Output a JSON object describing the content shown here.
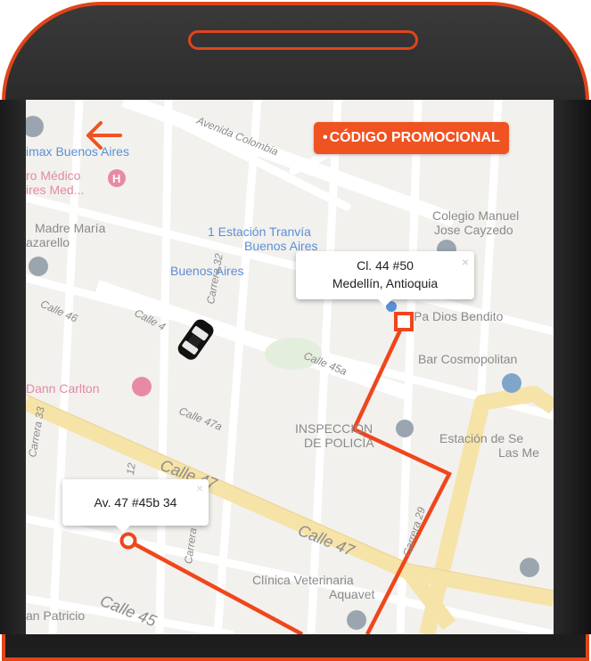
{
  "header": {
    "back_icon": "arrow-left-icon",
    "promo_label": "CÓDIGO PROMOCIONAL"
  },
  "colors": {
    "accent": "#f05322",
    "route": "#f0461b",
    "phone_frame": "#e0451a"
  },
  "map": {
    "places": {
      "cinema": "imax Buenos Aires",
      "medical_1": "ro Médico",
      "medical_2": "ires Med...",
      "church_1": "Madre María",
      "church_2": "azarello",
      "station_1": "1 Estación Tranvía",
      "station_2": "Buenos Aires",
      "buenos_aires": "Buenos Aires",
      "school_1": "Colegio Manuel",
      "school_2": "Jose Cayzedo",
      "pa_dios": "Pa Dios Bendito",
      "bar": "Bar Cosmopolitan",
      "hotel": "Dann Carlton",
      "inspeccion_1": "INSPECCIÓN",
      "inspeccion_2": "DE POLICÍA",
      "estacion_1": "Estación de Se",
      "estacion_2": "Las Me",
      "vet_1": "Clínica Veterinaria",
      "vet_2": "Aquavet",
      "san_patricio": "an Patricio"
    },
    "roads": {
      "colombia": "Avenida Colombia",
      "carrera_32": "Carrera 32",
      "calle_46": "Calle 46",
      "calle_4": "Calle 4",
      "calle_45a": "Calle 45a",
      "calle_47a": "Calle 47a",
      "calle_47_big": "Calle 47",
      "calle_47_b": "Calle 47",
      "carrera_29": "Carrera 29",
      "carrera_33": "Carrera 33",
      "carrera": "Carrera",
      "calle_45": "Calle 45",
      "cra_12": "12"
    }
  },
  "destination": {
    "line1": "Cl. 44 #50",
    "line2": "Medellín, Antioquia",
    "close": "×"
  },
  "origin": {
    "line1": "Av. 47 #45b 34",
    "close": "×"
  }
}
